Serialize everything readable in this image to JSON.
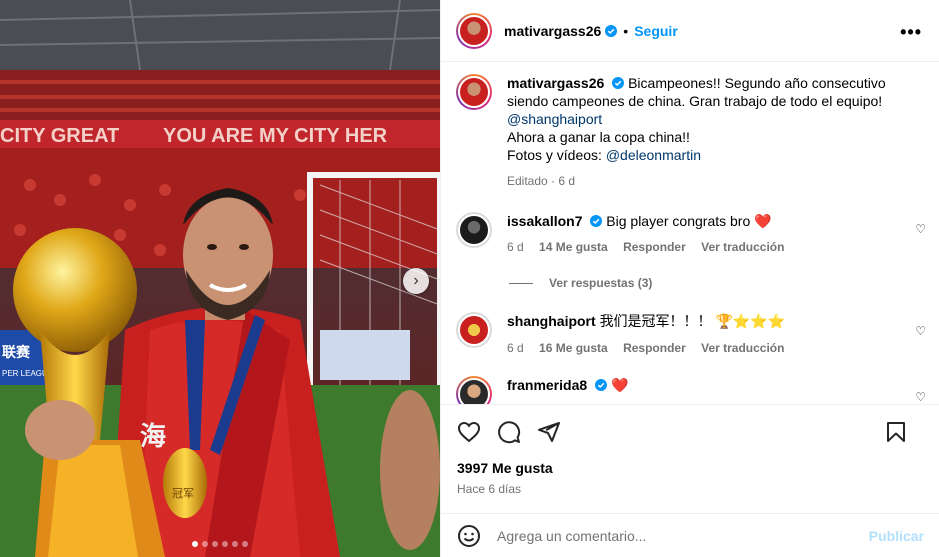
{
  "post": {
    "author": "mativargass26",
    "follow_label": "Seguir",
    "separator": "•",
    "more_icon": "•••"
  },
  "photo": {
    "banner_left": "CITY GREAT",
    "banner_right": "YOU ARE MY CITY HER",
    "jersey_text": "海",
    "medal_text": "冠军",
    "board_text": "联赛",
    "board_sub": "PER LEAGUE",
    "carousel_count": 6,
    "carousel_active_index": 0
  },
  "caption": {
    "username": "mativargass26",
    "line1": "Bicampeones!! Segundo año consecutivo siendo campeones de china. Gran trabajo de todo el equipo!",
    "mention1": "@shanghaiport",
    "line2": "Ahora a ganar la copa china!!",
    "line3_prefix": "Fotos y vídeos: ",
    "mention2": "@deleonmartin",
    "meta": "Editado · 6 d"
  },
  "comments": [
    {
      "username": "issakallon7",
      "text": "Big player congrats bro",
      "emoji": "❤️",
      "time": "6 d",
      "likes": "14 Me gusta",
      "reply": "Responder",
      "translate": "Ver traducción"
    },
    {
      "username": "shanghaiport",
      "text": "我们是冠军！！！",
      "emoji": "🏆⭐⭐⭐",
      "time": "6 d",
      "likes": "16 Me gusta",
      "reply": "Responder",
      "translate": "Ver traducción"
    },
    {
      "username": "franmerida8",
      "text": "",
      "emoji": "❤️"
    }
  ],
  "replies_label": "Ver respuestas (3)",
  "likes_count": "3997 Me gusta",
  "posted_ago": "Hace 6 días",
  "comment_box": {
    "placeholder": "Agrega un comentario...",
    "publish_label": "Publicar"
  },
  "colors": {
    "link": "#00376b",
    "follow": "#0095f6",
    "publish_disabled": "#b2dffc",
    "verified": "#0095f6",
    "heart": "#ed1c24"
  }
}
